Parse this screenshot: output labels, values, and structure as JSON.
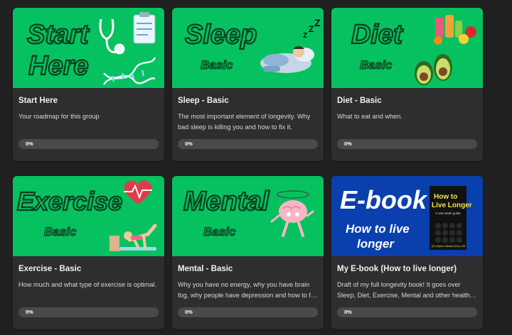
{
  "courses": [
    {
      "title": "Start Here",
      "description": "Your roadmap for this group",
      "progress_label": "0%",
      "progress": 0,
      "thumb_text": [
        "Start",
        "Here"
      ],
      "thumb_sub": "",
      "thumb_color": "#05c160"
    },
    {
      "title": "Sleep - Basic",
      "description": "The most important element of longevity. Why bad sleep is killing you and how to fix it.",
      "progress_label": "0%",
      "progress": 0,
      "thumb_text": [
        "Sleep"
      ],
      "thumb_sub": "Basic",
      "thumb_color": "#05c160"
    },
    {
      "title": "Diet - Basic",
      "description": "What to eat and when.",
      "progress_label": "0%",
      "progress": 0,
      "thumb_text": [
        "Diet"
      ],
      "thumb_sub": "Basic",
      "thumb_color": "#05c160"
    },
    {
      "title": "Exercise - Basic",
      "description": "How much and what type of exercise is optimal.",
      "progress_label": "0%",
      "progress": 0,
      "thumb_text": [
        "Exercise"
      ],
      "thumb_sub": "Basic",
      "thumb_color": "#05c160"
    },
    {
      "title": "Mental - Basic",
      "description": "Why you have no energy, why you have brain fog, why people have depression and how to fix it.",
      "progress_label": "0%",
      "progress": 0,
      "thumb_text": [
        "Mental"
      ],
      "thumb_sub": "Basic",
      "thumb_color": "#05c160"
    },
    {
      "title": "My E-book (How to live longer)",
      "description": "Draft of my full longevity book! It goes over Sleep, Diet, Exercise, Mental and other health topics.",
      "progress_label": "0%",
      "progress": 0,
      "thumb_text": [
        "E-book"
      ],
      "thumb_sub": "How to live longer",
      "thumb_color": "#0a3fae",
      "book_cover": {
        "title": "How to Live Longer",
        "subtitle": "A one-week guide",
        "author": "(Dr.) Byron Zamora (Cm), MD"
      }
    }
  ]
}
